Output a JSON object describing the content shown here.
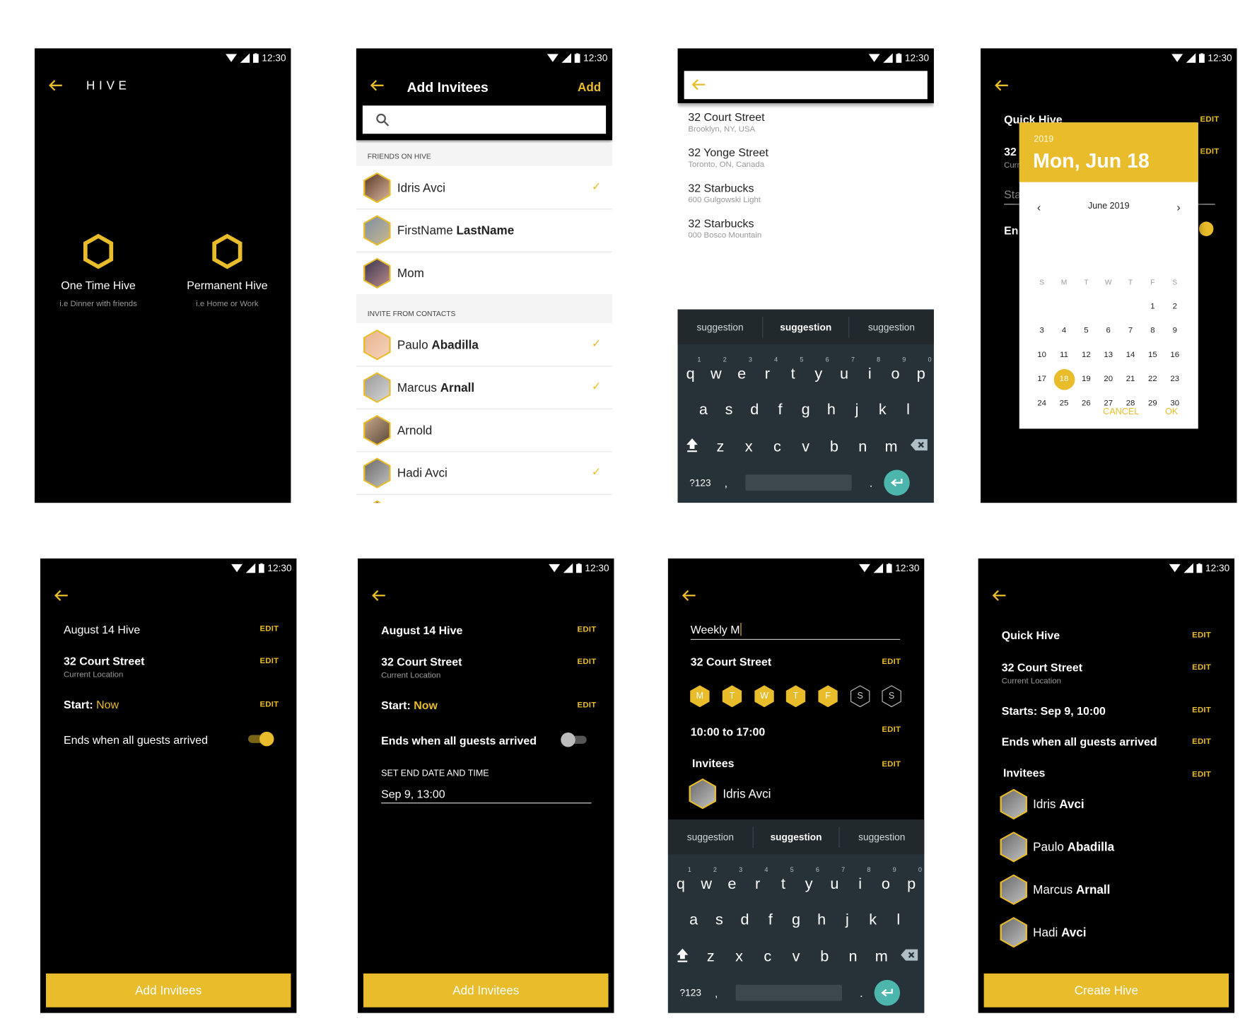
{
  "status": {
    "time": "12:30"
  },
  "colors": {
    "accent": "#e8bc2a",
    "keyboard": "#263238",
    "enter": "#4db6ac"
  },
  "screen_hive": {
    "title": "HIVE",
    "options": [
      {
        "label": "One Time Hive",
        "sub": "i.e Dinner with friends",
        "icon": "hexagon-icon"
      },
      {
        "label": "Permanent Hive",
        "sub": "i.e Home or Work",
        "icon": "hexagon-icon"
      }
    ]
  },
  "screen_invitees": {
    "title": "Add Invitees",
    "action": "Add",
    "search_placeholder": "",
    "section_friends": "FRIENDS ON HIVE",
    "section_contacts": "INVITE FROM CONTACTS",
    "friends": [
      {
        "first": "Idris Avci",
        "last": "",
        "checked": true
      },
      {
        "first": "FirstName ",
        "last": "LastName",
        "checked": false
      },
      {
        "first": "Mom",
        "last": "",
        "checked": false
      }
    ],
    "contacts": [
      {
        "first": "Paulo ",
        "last": "Abadilla",
        "checked": true
      },
      {
        "first": "Marcus ",
        "last": "Arnall",
        "checked": true
      },
      {
        "first": "Arnold",
        "last": "",
        "checked": false
      },
      {
        "first": "Hadi Avci",
        "last": "",
        "checked": true
      }
    ]
  },
  "screen_location": {
    "search_value": "",
    "results": [
      {
        "title": "32 Court Street",
        "sub": "Brooklyn, NY, USA"
      },
      {
        "title": "32 Yonge Street",
        "sub": "Toronto, ON, Canada"
      },
      {
        "title": "32 Starbucks",
        "sub": "600 Gulgowski Light"
      },
      {
        "title": "32 Starbucks",
        "sub": "000 Bosco Mountain"
      }
    ]
  },
  "keyboard": {
    "suggestions": [
      "suggestion",
      "suggestion",
      "suggestion"
    ],
    "row1": [
      "q",
      "w",
      "e",
      "r",
      "t",
      "y",
      "u",
      "i",
      "o",
      "p"
    ],
    "numbers": [
      "1",
      "2",
      "3",
      "4",
      "5",
      "6",
      "7",
      "8",
      "9",
      "0"
    ],
    "row2": [
      "a",
      "s",
      "d",
      "f",
      "g",
      "h",
      "j",
      "k",
      "l"
    ],
    "row3": [
      "z",
      "x",
      "c",
      "v",
      "b",
      "n",
      "m"
    ],
    "symbols": "?123",
    "comma": ",",
    "period": "."
  },
  "screen_datepicker": {
    "bg_title": "Quick Hive",
    "bg_edit": "EDIT",
    "bg_address": "32",
    "bg_sub": "Curr",
    "bg_start": "Sta",
    "bg_ends": "En",
    "year": "2019",
    "date": "Mon, Jun 18",
    "month": "June 2019",
    "weekdays": [
      "S",
      "M",
      "T",
      "W",
      "T",
      "F",
      "S"
    ],
    "weeks": [
      [
        null,
        null,
        null,
        null,
        null,
        1,
        2
      ],
      [
        3,
        4,
        5,
        6,
        7,
        8,
        9
      ],
      [
        10,
        11,
        12,
        13,
        14,
        15,
        16
      ],
      [
        17,
        18,
        19,
        20,
        21,
        22,
        23
      ],
      [
        24,
        25,
        26,
        27,
        28,
        29,
        30
      ]
    ],
    "selected": 18,
    "cancel": "CANCEL",
    "ok": "OK"
  },
  "screen_summary_on": {
    "title": "August 14 Hive",
    "address": "32 Court Street",
    "address_sub": "Current Location",
    "start_label": "Start: ",
    "start_value": "Now",
    "ends": "Ends when all guests arrived",
    "ends_toggle": true,
    "edit": "EDIT",
    "button": "Add Invitees"
  },
  "screen_summary_off": {
    "title": "August 14 Hive",
    "address": "32 Court Street",
    "address_sub": "Current Location",
    "start_label": "Start: ",
    "start_value": "Now",
    "ends": "Ends when all guests arrived",
    "ends_toggle": false,
    "end_label": "SET END DATE AND TIME",
    "end_value": "Sep 9, 13:00",
    "edit": "EDIT",
    "button": "Add Invitees"
  },
  "screen_weekly": {
    "name_value": "Weekly M",
    "address": "32 Court Street",
    "days": [
      {
        "l": "M",
        "on": true
      },
      {
        "l": "T",
        "on": true
      },
      {
        "l": "W",
        "on": true
      },
      {
        "l": "T",
        "on": true
      },
      {
        "l": "F",
        "on": true
      },
      {
        "l": "S",
        "on": false
      },
      {
        "l": "S",
        "on": false
      }
    ],
    "time": "10:00 to 17:00",
    "invitees_label": "Invitees",
    "invitees": [
      "Idris Avci"
    ],
    "edit": "EDIT"
  },
  "screen_create": {
    "title": "Quick Hive",
    "address": "32 Court Street",
    "address_sub": "Current Location",
    "starts": "Starts: Sep 9, 10:00",
    "ends": "Ends when all guests arrived",
    "invitees_label": "Invitees",
    "invitees": [
      {
        "first": "Idris ",
        "last": "Avci"
      },
      {
        "first": "Paulo ",
        "last": "Abadilla"
      },
      {
        "first": "Marcus ",
        "last": "Arnall"
      },
      {
        "first": "Hadi ",
        "last": "Avci"
      }
    ],
    "edit": "EDIT",
    "button": "Create Hive"
  }
}
